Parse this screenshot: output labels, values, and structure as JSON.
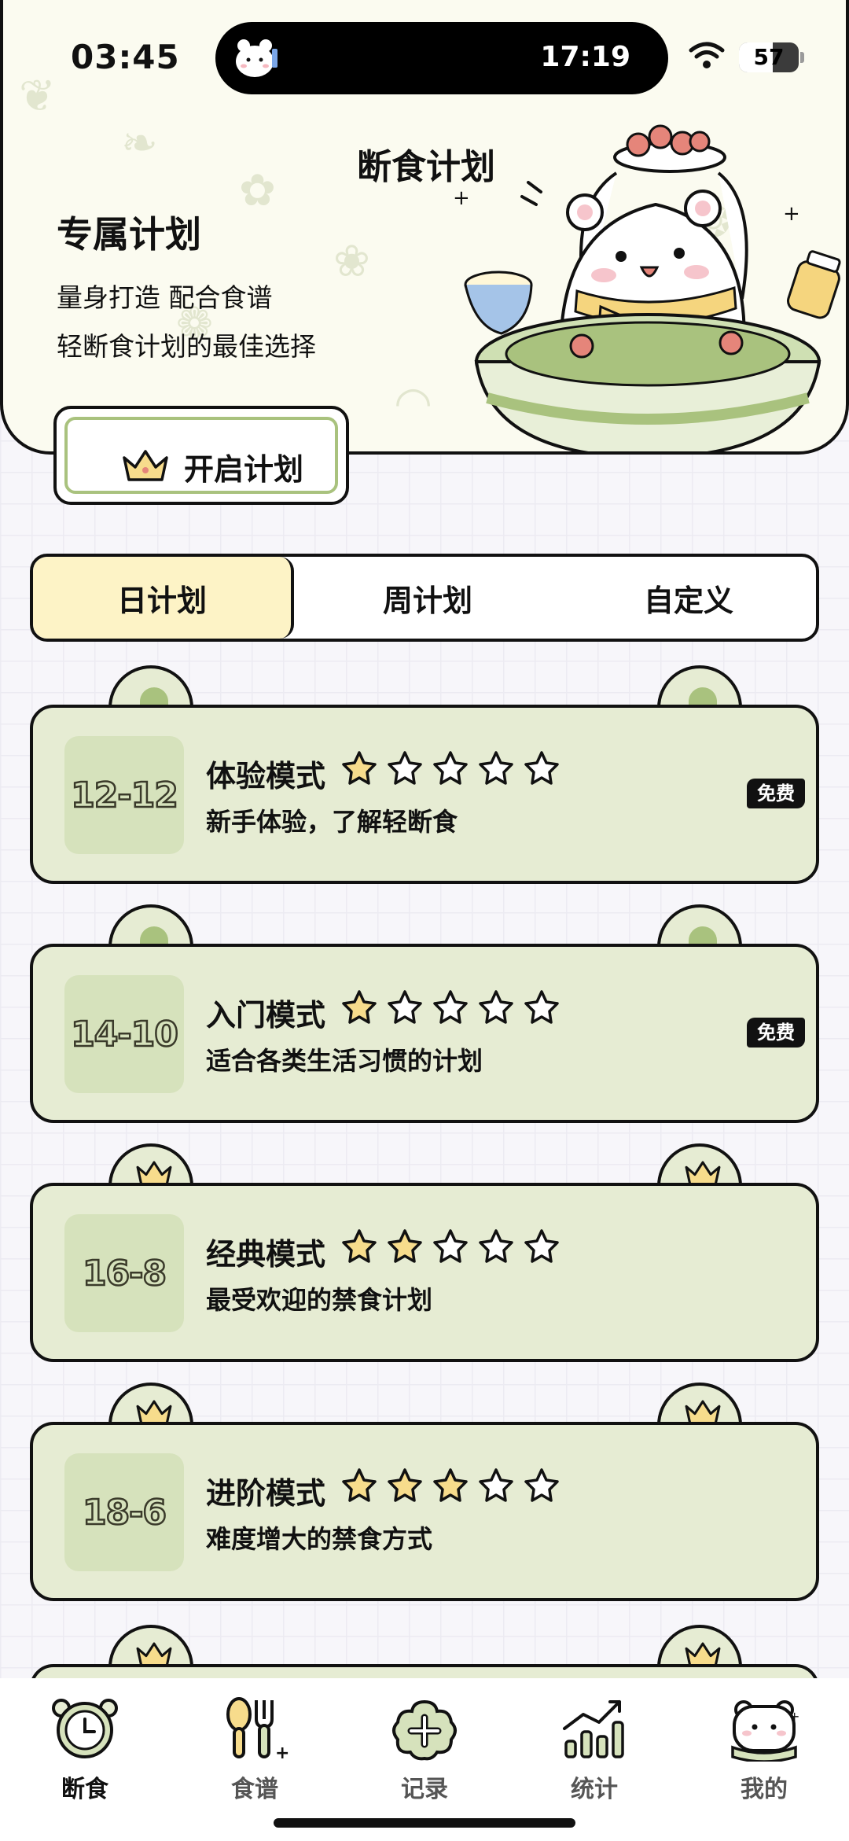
{
  "status_bar": {
    "time": "03:45",
    "island_time": "17:19",
    "battery_level": 57
  },
  "hero": {
    "title": "断食计划",
    "subtitle": "专属计划",
    "line1": "量身打造 配合食谱",
    "line2": "轻断食计划的最佳选择",
    "start_button": "开启计划"
  },
  "tabs": [
    {
      "label": "日计划",
      "active": true
    },
    {
      "label": "周计划",
      "active": false
    },
    {
      "label": "自定义",
      "active": false
    }
  ],
  "plans": [
    {
      "ratio": "12-12",
      "name": "体验模式",
      "stars": 1,
      "max_stars": 5,
      "desc": "新手体验，了解轻断食",
      "badge": "免费",
      "premium": false
    },
    {
      "ratio": "14-10",
      "name": "入门模式",
      "stars": 1,
      "max_stars": 5,
      "desc": "适合各类生活习惯的计划",
      "badge": "免费",
      "premium": false
    },
    {
      "ratio": "16-8",
      "name": "经典模式",
      "stars": 2,
      "max_stars": 5,
      "desc": "最受欢迎的禁食计划",
      "badge": "",
      "premium": true
    },
    {
      "ratio": "18-6",
      "name": "进阶模式",
      "stars": 3,
      "max_stars": 5,
      "desc": "难度增大的禁食方式",
      "badge": "",
      "premium": true
    }
  ],
  "nav": [
    {
      "label": "断食",
      "icon": "clock-icon",
      "active": true
    },
    {
      "label": "食谱",
      "icon": "spoon-fork-icon",
      "active": false
    },
    {
      "label": "记录",
      "icon": "add-record-icon",
      "active": false
    },
    {
      "label": "统计",
      "icon": "chart-icon",
      "active": false
    },
    {
      "label": "我的",
      "icon": "bear-profile-icon",
      "active": false
    }
  ],
  "colors": {
    "accent_green": "#a9c27e",
    "card_bg": "#e6ecd3",
    "tab_active": "#fdf3c6",
    "star_fill": "#f7dc8c"
  }
}
